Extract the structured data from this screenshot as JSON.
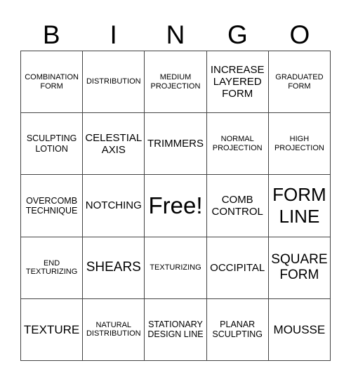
{
  "header": [
    "B",
    "I",
    "N",
    "G",
    "O"
  ],
  "cells": [
    {
      "text": "COMBINATION FORM",
      "size": "s1"
    },
    {
      "text": "DISTRIBUTION",
      "size": "s1"
    },
    {
      "text": "MEDIUM PROJECTION",
      "size": "s1"
    },
    {
      "text": "INCREASE LAYERED FORM",
      "size": "s2"
    },
    {
      "text": "GRADUATED FORM",
      "size": "s1"
    },
    {
      "text": "SCULPTING LOTION",
      "size": "s1b"
    },
    {
      "text": "CELESTIAL AXIS",
      "size": "s2"
    },
    {
      "text": "TRIMMERS",
      "size": "s2"
    },
    {
      "text": "NORMAL PROJECTION",
      "size": "s1"
    },
    {
      "text": "HIGH PROJECTION",
      "size": "s1"
    },
    {
      "text": "OVERCOMB TECHNIQUE",
      "size": "s1b"
    },
    {
      "text": "NOTCHING",
      "size": "s2"
    },
    {
      "text": "Free!",
      "size": "s5"
    },
    {
      "text": "COMB CONTROL",
      "size": "s2"
    },
    {
      "text": "FORM LINE",
      "size": "s4"
    },
    {
      "text": "END TEXTURIZING",
      "size": "s1"
    },
    {
      "text": "SHEARS",
      "size": "s3"
    },
    {
      "text": "TEXTURIZING",
      "size": "s1"
    },
    {
      "text": "OCCIPITAL",
      "size": "s2"
    },
    {
      "text": "SQUARE FORM",
      "size": "s3"
    },
    {
      "text": "TEXTURE",
      "size": "s2b"
    },
    {
      "text": "NATURAL DISTRIBUTION",
      "size": "s1"
    },
    {
      "text": "STATIONARY DESIGN LINE",
      "size": "s1b"
    },
    {
      "text": "PLANAR SCULPTING",
      "size": "s1b"
    },
    {
      "text": "MOUSSE",
      "size": "s2b"
    }
  ]
}
